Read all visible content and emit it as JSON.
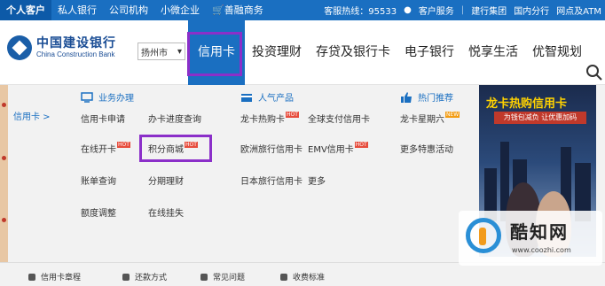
{
  "topbar": {
    "items": [
      "个人客户",
      "私人银行",
      "公司机构",
      "小微企业",
      "善融商务"
    ],
    "hotline": "客服热线：95533",
    "service": "客户服务",
    "group": "建行集团",
    "domestic": "国内分行",
    "network": "网点及ATM"
  },
  "header": {
    "logo_cn": "中国建设银行",
    "logo_en": "China Construction Bank",
    "city": "扬州市",
    "nav": [
      "信用卡",
      "投资理财",
      "存贷及银行卡",
      "电子银行",
      "悦享生活",
      "优智规划"
    ]
  },
  "menu": {
    "side_label": "信用卡 >",
    "col1_title": "业务办理",
    "col2_title": "人气产品",
    "col3_title": "热门推荐",
    "links": {
      "apply": "信用卡申请",
      "progress": "办卡进度查询",
      "activate": "在线开卡",
      "points": "积分商城",
      "bill": "账单查询",
      "installment": "分期理财",
      "limit": "额度调整",
      "report_loss": "在线挂失",
      "hot_card": "龙卡热购卡",
      "global_pay": "全球支付信用卡",
      "europe": "欧洲旅行信用卡",
      "emv": "EMV信用卡",
      "japan": "日本旅行信用卡",
      "more": "更多",
      "saturday": "龙卡星期六",
      "offers": "更多特惠活动"
    },
    "hot_badge": "HOT",
    "new_badge": "NEW"
  },
  "ad": {
    "title": "龙卡热购信用卡",
    "subtitle": "为钱包减负 让优惠加码"
  },
  "bottom": {
    "items": [
      "信用卡章程",
      "还款方式",
      "常见问题",
      "收费标准"
    ]
  },
  "watermark": {
    "name": "酷知网",
    "url": "www.coozhi.com"
  },
  "colors": {
    "brand_blue": "#1a6fc1",
    "highlight_purple": "#8b2fc9"
  }
}
